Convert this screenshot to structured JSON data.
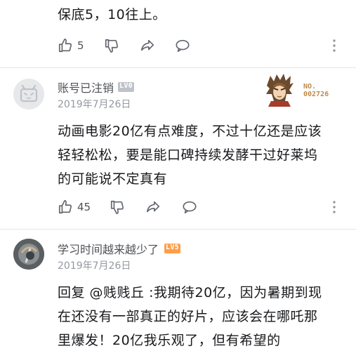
{
  "comment0": {
    "text_tail": "保底5，10往上。",
    "like_count": "5"
  },
  "comment1": {
    "username": "账号已注销",
    "level": "LV0",
    "date": "2019年7月26日",
    "fan_badge_number": "NO.\n002726",
    "lines": [
      "动画电影20亿有点难度，不过十亿还是应该",
      "轻轻松松，要是能口碑持续发酵干过好莱坞",
      "的可能说不定真有"
    ],
    "like_count": "45"
  },
  "comment2": {
    "username": "学习时间越来越少了",
    "level": "LV5",
    "date": "2019年7月26日",
    "lines": [
      "回复 @贱贱丘 :我期待20亿，因为暑期到现",
      "在还没有一部真正的好片，应该会在哪吒那",
      "里爆发！20亿我乐观了，但有希望的"
    ]
  },
  "icons": {
    "like": "thumbs-up-icon",
    "dislike": "thumbs-down-icon",
    "share": "share-icon",
    "reply": "comment-icon",
    "more": "more-vertical-icon"
  },
  "colors": {
    "text": "#18191c",
    "muted": "#9499a0",
    "icon": "#61666d",
    "divider": "#e3e5e7"
  }
}
